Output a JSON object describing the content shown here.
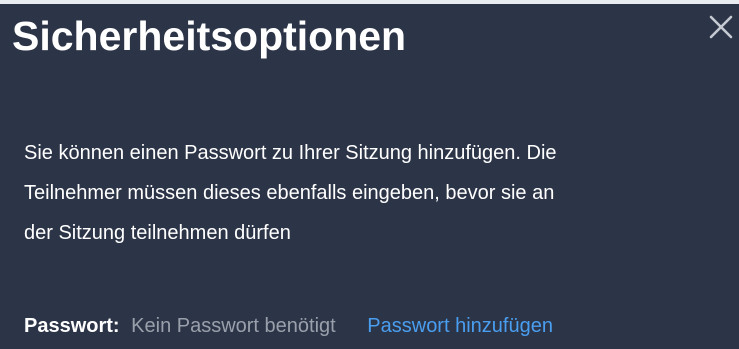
{
  "dialog": {
    "title": "Sicherheitsoptionen",
    "close_icon": "close-x-icon",
    "description_lines": [
      "Sie können einen Passwort zu Ihrer Sitzung hinzufügen. Die",
      "Teilnehmer müssen dieses ebenfalls eingeben, bevor sie an",
      "der Sitzung teilnehmen dürfen"
    ],
    "password": {
      "label": "Passwort:",
      "value": "Kein Passwort benötigt",
      "add_link": "Passwort hinzufügen"
    }
  },
  "colors": {
    "background": "#2c3447",
    "text": "#ffffff",
    "muted": "#9aa0ab",
    "link": "#4a9ef0"
  }
}
